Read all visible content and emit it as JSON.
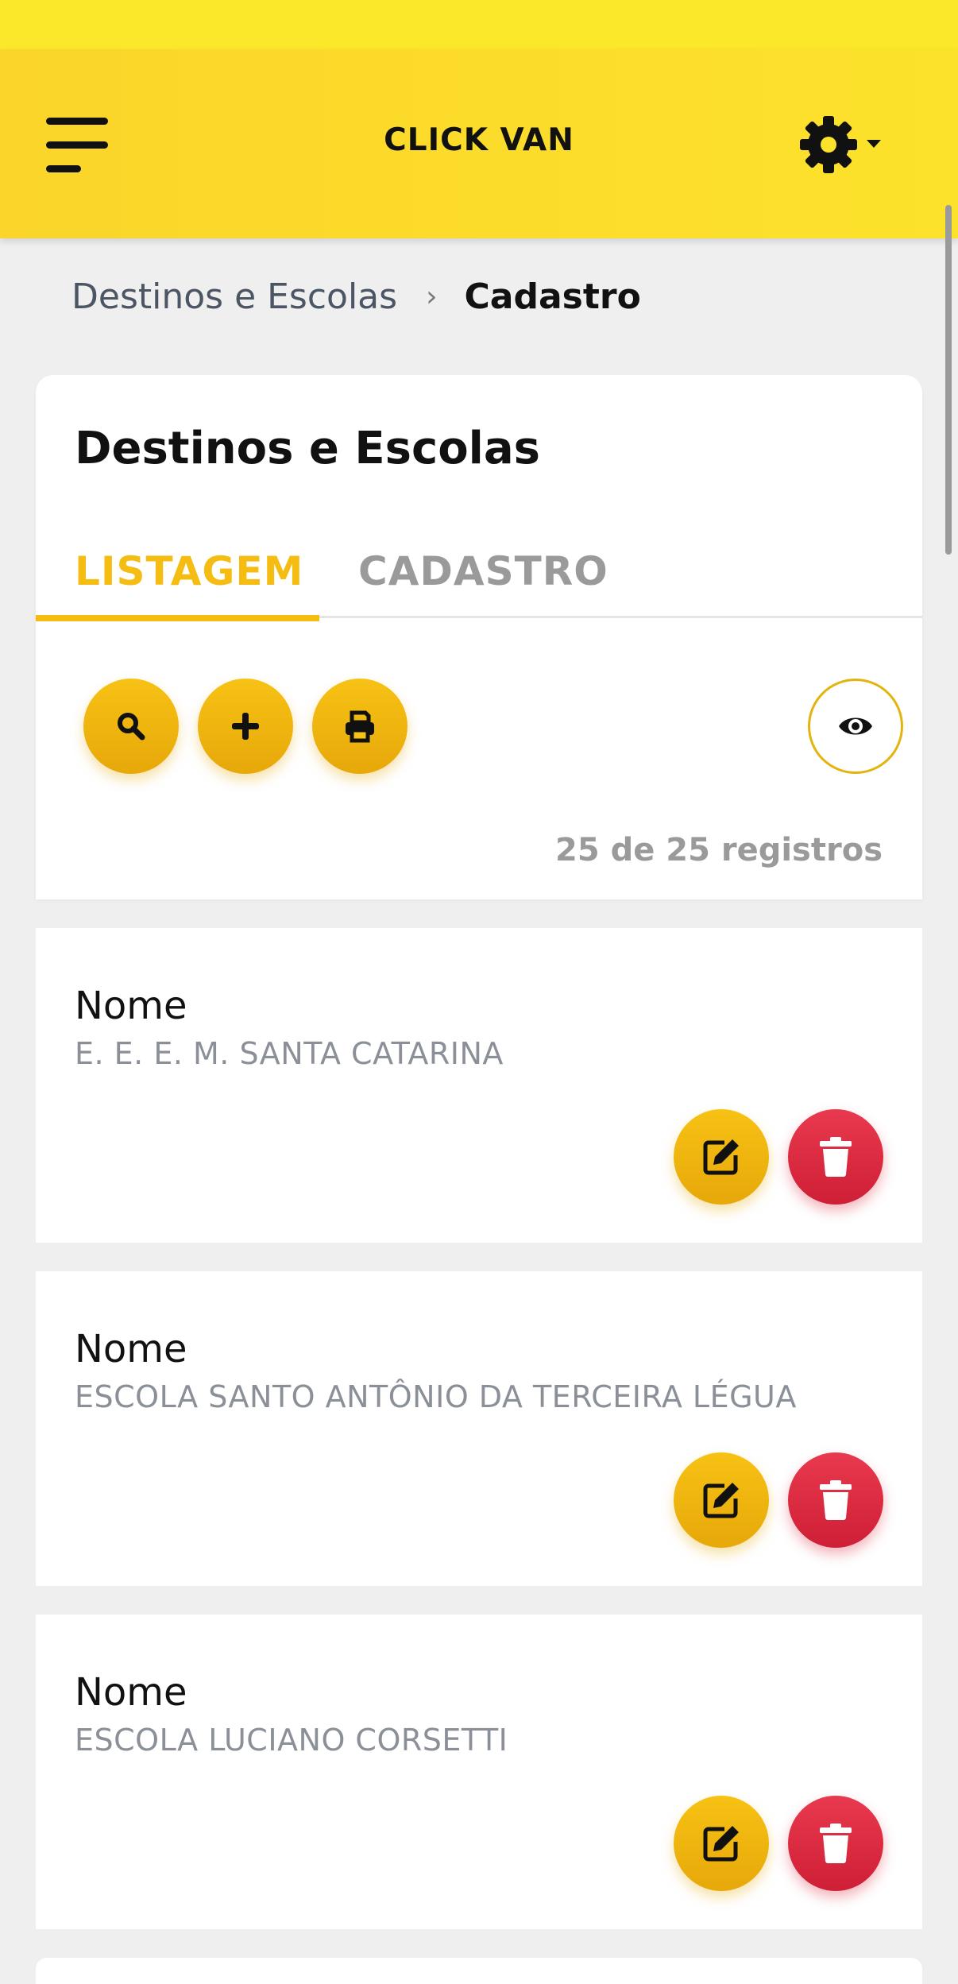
{
  "app": {
    "title": "CLICK VAN",
    "menu_icon": "hamburger-menu-icon",
    "settings_icon": "gear-icon",
    "colors": {
      "accent": "#f5bd12",
      "appbar": "#fce22b",
      "danger": "#d9283f"
    }
  },
  "breadcrumb": {
    "parent": "Destinos e Escolas",
    "separator": "›",
    "current": "Cadastro"
  },
  "page": {
    "title": "Destinos e Escolas",
    "tabs": [
      {
        "label": "LISTAGEM",
        "active": true
      },
      {
        "label": "CADASTRO",
        "active": false
      }
    ],
    "toolbar": {
      "search_icon": "search-icon",
      "add_icon": "plus-icon",
      "print_icon": "print-icon",
      "view_icon": "eye-icon"
    },
    "record_count": "25 de 25 registros"
  },
  "items": [
    {
      "label": "Nome",
      "value": "E. E. E. M. SANTA CATARINA"
    },
    {
      "label": "Nome",
      "value": "ESCOLA SANTO ANTÔNIO DA TERCEIRA LÉGUA"
    },
    {
      "label": "Nome",
      "value": "ESCOLA LUCIANO CORSETTI"
    }
  ]
}
